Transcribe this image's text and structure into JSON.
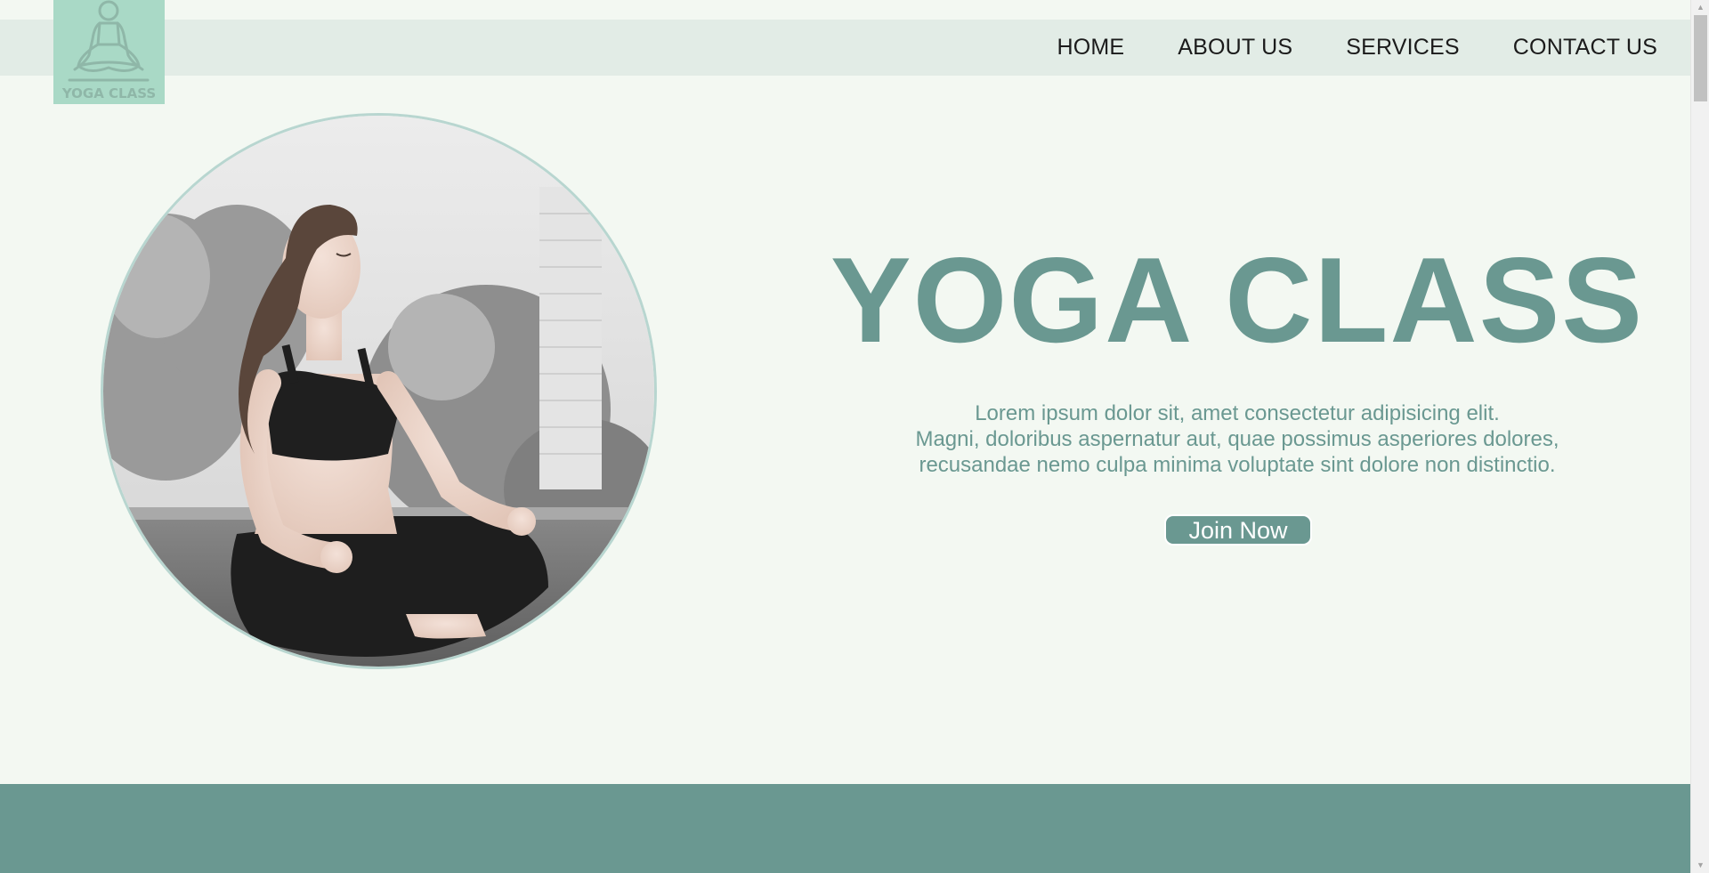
{
  "logo": {
    "text": "YOGA CLASS",
    "icon": "meditating-person-icon"
  },
  "nav": {
    "items": [
      {
        "label": "HOME"
      },
      {
        "label": "ABOUT US"
      },
      {
        "label": "SERVICES"
      },
      {
        "label": "CONTACT US"
      }
    ]
  },
  "hero": {
    "image": "woman-meditating-photo",
    "title": "YOGA CLASS",
    "description_lines": [
      "Lorem ipsum dolor sit, amet consectetur adipisicing elit.",
      "Magni, doloribus aspernatur aut, quae possimus asperiores dolores,",
      "recusandae nemo culpa minima voluptate sint dolore non distinctio."
    ],
    "cta_label": "Join Now"
  },
  "colors": {
    "background": "#f3f8f2",
    "navbar": "#e2ece6",
    "logo_bg": "#a9d9c6",
    "accent": "#6a9891",
    "button_text": "#ffffff"
  },
  "scrollbar": {
    "up_icon": "chevron-up-icon",
    "down_icon": "chevron-down-icon"
  }
}
